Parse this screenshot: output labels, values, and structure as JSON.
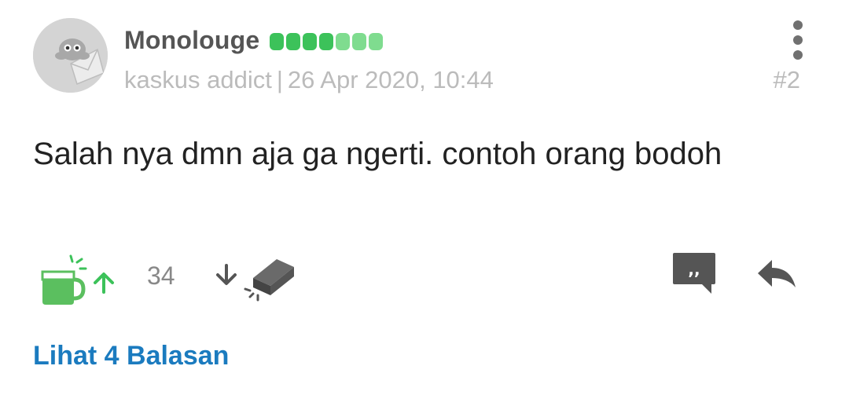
{
  "post": {
    "user": {
      "name": "Monolouge",
      "rank": "kaskus addict",
      "avatar_icon": "kaskus-bot-avatar",
      "reputation": {
        "filled": 4,
        "total": 7,
        "filled_color": "#3cc25a",
        "light_color": "#7fdc8f"
      }
    },
    "meta": {
      "separator": "|",
      "timestamp": "26 Apr 2020, 10:44",
      "post_number": "#2"
    },
    "content": "Salah nya dmn aja ga ngerti. contoh orang bodoh",
    "actions": {
      "upvote_icon": "cendol-cup-icon",
      "vote_count": "34",
      "downvote_icon": "brick-icon",
      "quote_icon": "quote-icon",
      "reply_icon": "reply-arrow-icon",
      "more_icon": "more-vertical-icon"
    },
    "view_replies_label": "Lihat 4 Balasan"
  },
  "colors": {
    "accent": "#1b7bbf",
    "upvote_green": "#3cc25a",
    "icon_gray": "#555555"
  }
}
